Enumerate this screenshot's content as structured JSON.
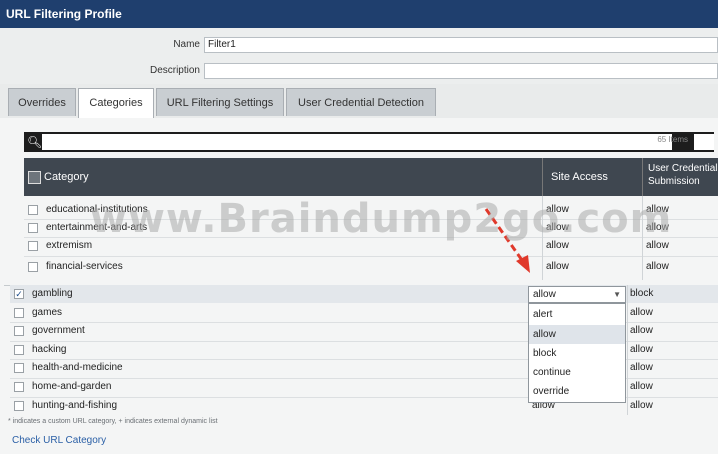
{
  "window": {
    "title": "URL Filtering Profile"
  },
  "form": {
    "name_label": "Name",
    "name_value": "Filter1",
    "description_label": "Description",
    "description_value": ""
  },
  "tabs": [
    {
      "label": "Overrides"
    },
    {
      "label": "Categories"
    },
    {
      "label": "URL Filtering Settings"
    },
    {
      "label": "User Credential Detection"
    }
  ],
  "search": {
    "count": "65 Items"
  },
  "table": {
    "headers": {
      "category": "Category",
      "site_access": "Site Access",
      "user_credential": "User Credential Submission"
    },
    "rows_top": [
      {
        "category": "educational-institutions",
        "site_access": "allow",
        "user_credential": "allow"
      },
      {
        "category": "entertainment-and-arts",
        "site_access": "allow",
        "user_credential": "allow"
      },
      {
        "category": "extremism",
        "site_access": "allow",
        "user_credential": "allow"
      },
      {
        "category": "financial-services",
        "site_access": "allow",
        "user_credential": "allow"
      }
    ],
    "selected_row": {
      "category": "gambling",
      "site_access": "allow",
      "user_credential": "block"
    },
    "rows_bottom": [
      {
        "category": "games",
        "user_credential": "allow"
      },
      {
        "category": "government",
        "user_credential": "allow"
      },
      {
        "category": "hacking",
        "user_credential": "allow"
      },
      {
        "category": "health-and-medicine",
        "user_credential": "allow"
      },
      {
        "category": "home-and-garden",
        "user_credential": "allow"
      },
      {
        "category": "hunting-and-fishing",
        "site_access": "allow",
        "user_credential": "allow"
      }
    ]
  },
  "dropdown": {
    "options": [
      "alert",
      "allow",
      "block",
      "continue",
      "override"
    ],
    "highlighted": "allow"
  },
  "footer": {
    "note": "* indicates a custom URL category, + indicates external dynamic list",
    "link": "Check URL Category"
  },
  "watermark": "www.Braindump2go.com",
  "colors": {
    "title_bar": "#1f3f6e",
    "header": "#3f4750",
    "link": "#2a5fa6",
    "arrow": "#e0392b"
  }
}
